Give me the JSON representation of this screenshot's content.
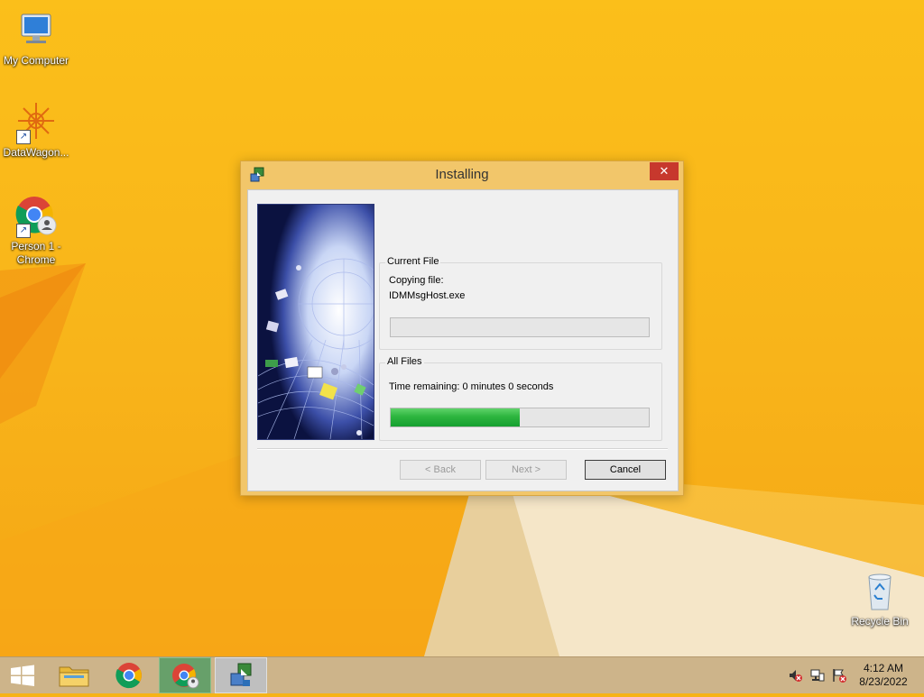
{
  "desktop": {
    "icons": [
      {
        "label": "My Computer",
        "icon": "computer-icon"
      },
      {
        "label": "DataWagon...",
        "icon": "datawagon-icon"
      },
      {
        "label": "Person 1 -\nChrome",
        "icon": "chrome-person-icon"
      },
      {
        "label": "Recycle Bin",
        "icon": "recycle-bin-icon"
      }
    ]
  },
  "dialog": {
    "title": "Installing",
    "close_label": "✕",
    "current_file": {
      "group_label": "Current File",
      "status": "Copying file:",
      "filename": "IDMMsgHost.exe",
      "progress": 0
    },
    "all_files": {
      "group_label": "All Files",
      "time_remaining": "Time remaining: 0 minutes 0 seconds",
      "progress": 0.5
    },
    "buttons": {
      "back": "< Back",
      "next": "Next >",
      "cancel": "Cancel"
    }
  },
  "taskbar": {
    "items": [
      {
        "name": "start",
        "icon": "windows-logo-icon"
      },
      {
        "name": "file-explorer",
        "icon": "folder-icon"
      },
      {
        "name": "chrome",
        "icon": "chrome-icon"
      },
      {
        "name": "chrome-person",
        "icon": "chrome-person-icon"
      },
      {
        "name": "installer",
        "icon": "installer-icon"
      }
    ],
    "tray_icons": [
      "volume-muted-icon",
      "network-icon",
      "action-center-flag-icon"
    ],
    "clock": {
      "time": "4:12 AM",
      "date": "8/23/2022"
    }
  },
  "colors": {
    "desktop": "#f8b41a",
    "progress_fill": "#16a030",
    "close_button": "#c7382d"
  }
}
